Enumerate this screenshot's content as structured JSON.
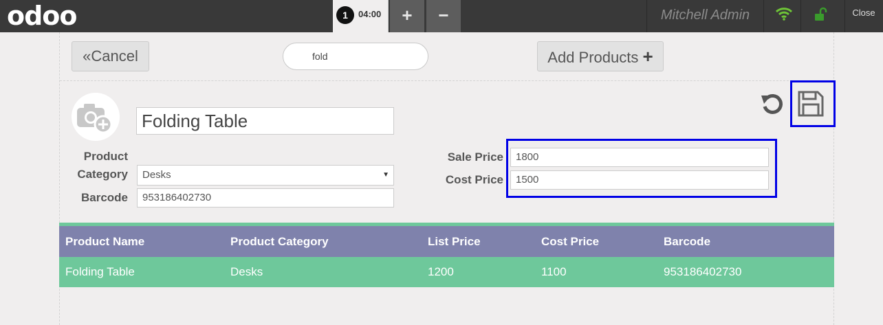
{
  "topbar": {
    "logo": "odoo",
    "order_number": "1",
    "order_time": "04:00",
    "add_order": "+",
    "remove_order": "−",
    "user_name": "Mitchell Admin",
    "close_label": "Close"
  },
  "actions": {
    "cancel_icon": "«",
    "cancel_label": "Cancel",
    "search_value": "fold",
    "add_products_label": "Add Products",
    "add_products_icon": "+"
  },
  "product": {
    "name": "Folding Table",
    "category_label_1": "Product",
    "category_label_2": "Category",
    "category_value": "Desks",
    "barcode_label": "Barcode",
    "barcode_value": "953186402730",
    "sale_price_label": "Sale Price",
    "sale_price_value": "1800",
    "cost_price_label": "Cost Price",
    "cost_price_value": "1500"
  },
  "table": {
    "headers": [
      "Product Name",
      "Product Category",
      "List Price",
      "Cost Price",
      "Barcode"
    ],
    "rows": [
      [
        "Folding Table",
        "Desks",
        "1200",
        "1100",
        "953186402730"
      ]
    ]
  },
  "icons": {
    "camera": "camera-add-icon",
    "undo": "undo-icon",
    "save": "save-icon",
    "wifi": "wifi-icon",
    "lock": "unlocked-icon"
  },
  "colors": {
    "topbar": "#393939",
    "table_header": "#7f82ac",
    "table_row": "#6ec89b",
    "highlight": "#0000e6",
    "wifi": "#6ec437",
    "lock": "#3a9b2c"
  }
}
